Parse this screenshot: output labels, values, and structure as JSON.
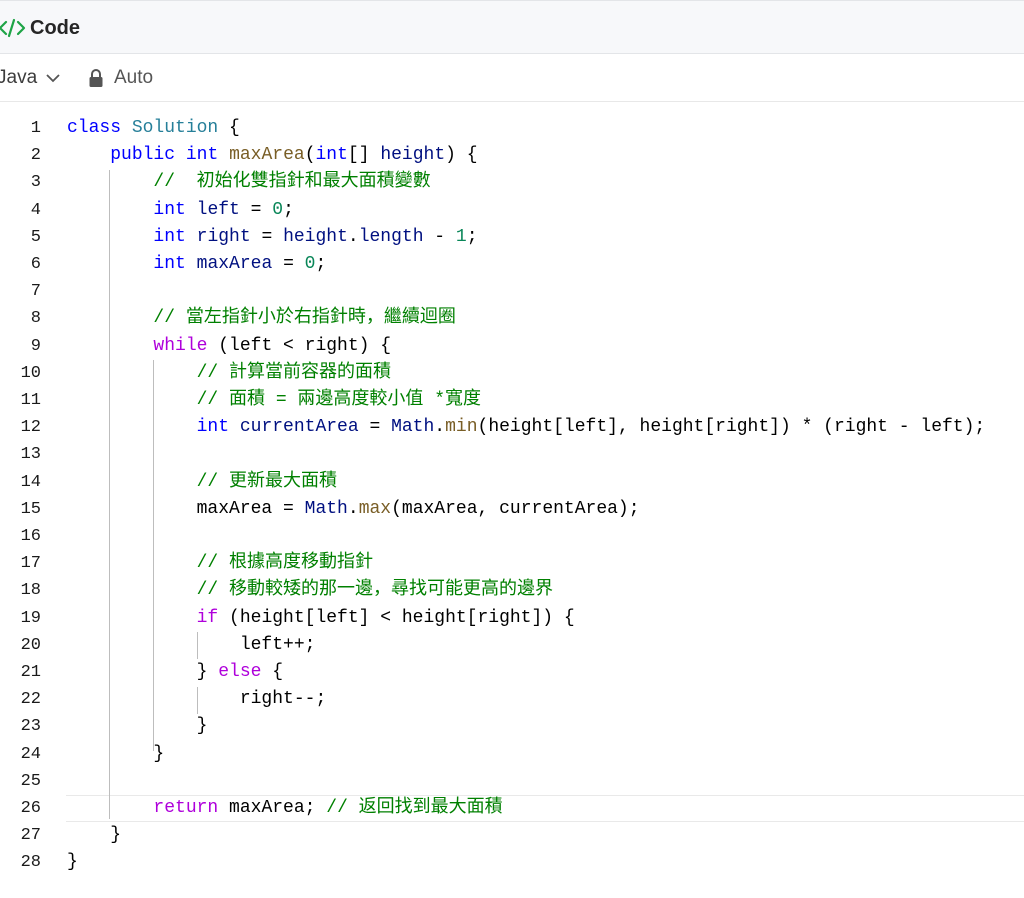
{
  "header": {
    "title": "Code",
    "icon": "code-icon"
  },
  "toolbar": {
    "language": "Java",
    "mode": "Auto"
  },
  "editor": {
    "current_line": 26,
    "lines": [
      {
        "n": "1",
        "tokens": [
          {
            "t": "class ",
            "c": "kw"
          },
          {
            "t": "Solution",
            "c": "cls"
          },
          {
            "t": " {",
            "c": ""
          }
        ]
      },
      {
        "n": "2",
        "tokens": [
          {
            "t": "    ",
            "c": ""
          },
          {
            "t": "public ",
            "c": "kw"
          },
          {
            "t": "int ",
            "c": "typ"
          },
          {
            "t": "maxArea",
            "c": "fn"
          },
          {
            "t": "(",
            "c": ""
          },
          {
            "t": "int",
            "c": "typ"
          },
          {
            "t": "[] ",
            "c": ""
          },
          {
            "t": "height",
            "c": "var"
          },
          {
            "t": ") {",
            "c": ""
          }
        ]
      },
      {
        "n": "3",
        "tokens": [
          {
            "t": "        ",
            "c": ""
          },
          {
            "t": "//  初始化雙指針和最大面積變數",
            "c": "cmt"
          }
        ]
      },
      {
        "n": "4",
        "tokens": [
          {
            "t": "        ",
            "c": ""
          },
          {
            "t": "int ",
            "c": "typ"
          },
          {
            "t": "left",
            "c": "var"
          },
          {
            "t": " = ",
            "c": ""
          },
          {
            "t": "0",
            "c": "num"
          },
          {
            "t": ";",
            "c": ""
          }
        ]
      },
      {
        "n": "5",
        "tokens": [
          {
            "t": "        ",
            "c": ""
          },
          {
            "t": "int ",
            "c": "typ"
          },
          {
            "t": "right",
            "c": "var"
          },
          {
            "t": " = ",
            "c": ""
          },
          {
            "t": "height",
            "c": "var"
          },
          {
            "t": ".",
            "c": ""
          },
          {
            "t": "length",
            "c": "var"
          },
          {
            "t": " - ",
            "c": ""
          },
          {
            "t": "1",
            "c": "num"
          },
          {
            "t": ";",
            "c": ""
          }
        ]
      },
      {
        "n": "6",
        "tokens": [
          {
            "t": "        ",
            "c": ""
          },
          {
            "t": "int ",
            "c": "typ"
          },
          {
            "t": "maxArea",
            "c": "var"
          },
          {
            "t": " = ",
            "c": ""
          },
          {
            "t": "0",
            "c": "num"
          },
          {
            "t": ";",
            "c": ""
          }
        ]
      },
      {
        "n": "7",
        "tokens": []
      },
      {
        "n": "8",
        "tokens": [
          {
            "t": "        ",
            "c": ""
          },
          {
            "t": "// 當左指針小於右指針時，繼續迴圈",
            "c": "cmt"
          }
        ]
      },
      {
        "n": "9",
        "tokens": [
          {
            "t": "        ",
            "c": ""
          },
          {
            "t": "while",
            "c": "ctl"
          },
          {
            "t": " (left < right) {",
            "c": ""
          }
        ]
      },
      {
        "n": "10",
        "tokens": [
          {
            "t": "            ",
            "c": ""
          },
          {
            "t": "// 計算當前容器的面積",
            "c": "cmt"
          }
        ]
      },
      {
        "n": "11",
        "tokens": [
          {
            "t": "            ",
            "c": ""
          },
          {
            "t": "// 面積 = 兩邊高度較小值 *寬度",
            "c": "cmt"
          }
        ]
      },
      {
        "n": "12",
        "tokens": [
          {
            "t": "            ",
            "c": ""
          },
          {
            "t": "int ",
            "c": "typ"
          },
          {
            "t": "currentArea",
            "c": "var"
          },
          {
            "t": " = ",
            "c": ""
          },
          {
            "t": "Math",
            "c": "var"
          },
          {
            "t": ".",
            "c": ""
          },
          {
            "t": "min",
            "c": "fn"
          },
          {
            "t": "(height[left], height[right]) * (right - left);",
            "c": ""
          }
        ]
      },
      {
        "n": "13",
        "tokens": []
      },
      {
        "n": "14",
        "tokens": [
          {
            "t": "            ",
            "c": ""
          },
          {
            "t": "// 更新最大面積",
            "c": "cmt"
          }
        ]
      },
      {
        "n": "15",
        "tokens": [
          {
            "t": "            ",
            "c": ""
          },
          {
            "t": "maxArea = ",
            "c": ""
          },
          {
            "t": "Math",
            "c": "var"
          },
          {
            "t": ".",
            "c": ""
          },
          {
            "t": "max",
            "c": "fn"
          },
          {
            "t": "(maxArea, currentArea);",
            "c": ""
          }
        ]
      },
      {
        "n": "16",
        "tokens": []
      },
      {
        "n": "17",
        "tokens": [
          {
            "t": "            ",
            "c": ""
          },
          {
            "t": "// 根據高度移動指針",
            "c": "cmt"
          }
        ]
      },
      {
        "n": "18",
        "tokens": [
          {
            "t": "            ",
            "c": ""
          },
          {
            "t": "// 移動較矮的那一邊，尋找可能更高的邊界",
            "c": "cmt"
          }
        ]
      },
      {
        "n": "19",
        "tokens": [
          {
            "t": "            ",
            "c": ""
          },
          {
            "t": "if",
            "c": "ctl"
          },
          {
            "t": " (height[left] < height[right]) {",
            "c": ""
          }
        ]
      },
      {
        "n": "20",
        "tokens": [
          {
            "t": "                left++;",
            "c": ""
          }
        ]
      },
      {
        "n": "21",
        "tokens": [
          {
            "t": "            } ",
            "c": ""
          },
          {
            "t": "else",
            "c": "ctl"
          },
          {
            "t": " {",
            "c": ""
          }
        ]
      },
      {
        "n": "22",
        "tokens": [
          {
            "t": "                right--;",
            "c": ""
          }
        ]
      },
      {
        "n": "23",
        "tokens": [
          {
            "t": "            }",
            "c": ""
          }
        ]
      },
      {
        "n": "24",
        "tokens": [
          {
            "t": "        }",
            "c": ""
          }
        ]
      },
      {
        "n": "25",
        "tokens": []
      },
      {
        "n": "26",
        "tokens": [
          {
            "t": "        ",
            "c": ""
          },
          {
            "t": "return",
            "c": "ctl"
          },
          {
            "t": " maxArea; ",
            "c": ""
          },
          {
            "t": "// 返回找到最大面積",
            "c": "cmt"
          }
        ]
      },
      {
        "n": "27",
        "tokens": [
          {
            "t": "    }",
            "c": ""
          }
        ]
      },
      {
        "n": "28",
        "tokens": [
          {
            "t": "}",
            "c": ""
          }
        ]
      }
    ]
  },
  "colors": {
    "keyword": "#0000ff",
    "control": "#af00db",
    "class": "#267f99",
    "function": "#795e26",
    "variable": "#001080",
    "number": "#098658",
    "comment": "#008000",
    "icon": "#1ea446"
  }
}
